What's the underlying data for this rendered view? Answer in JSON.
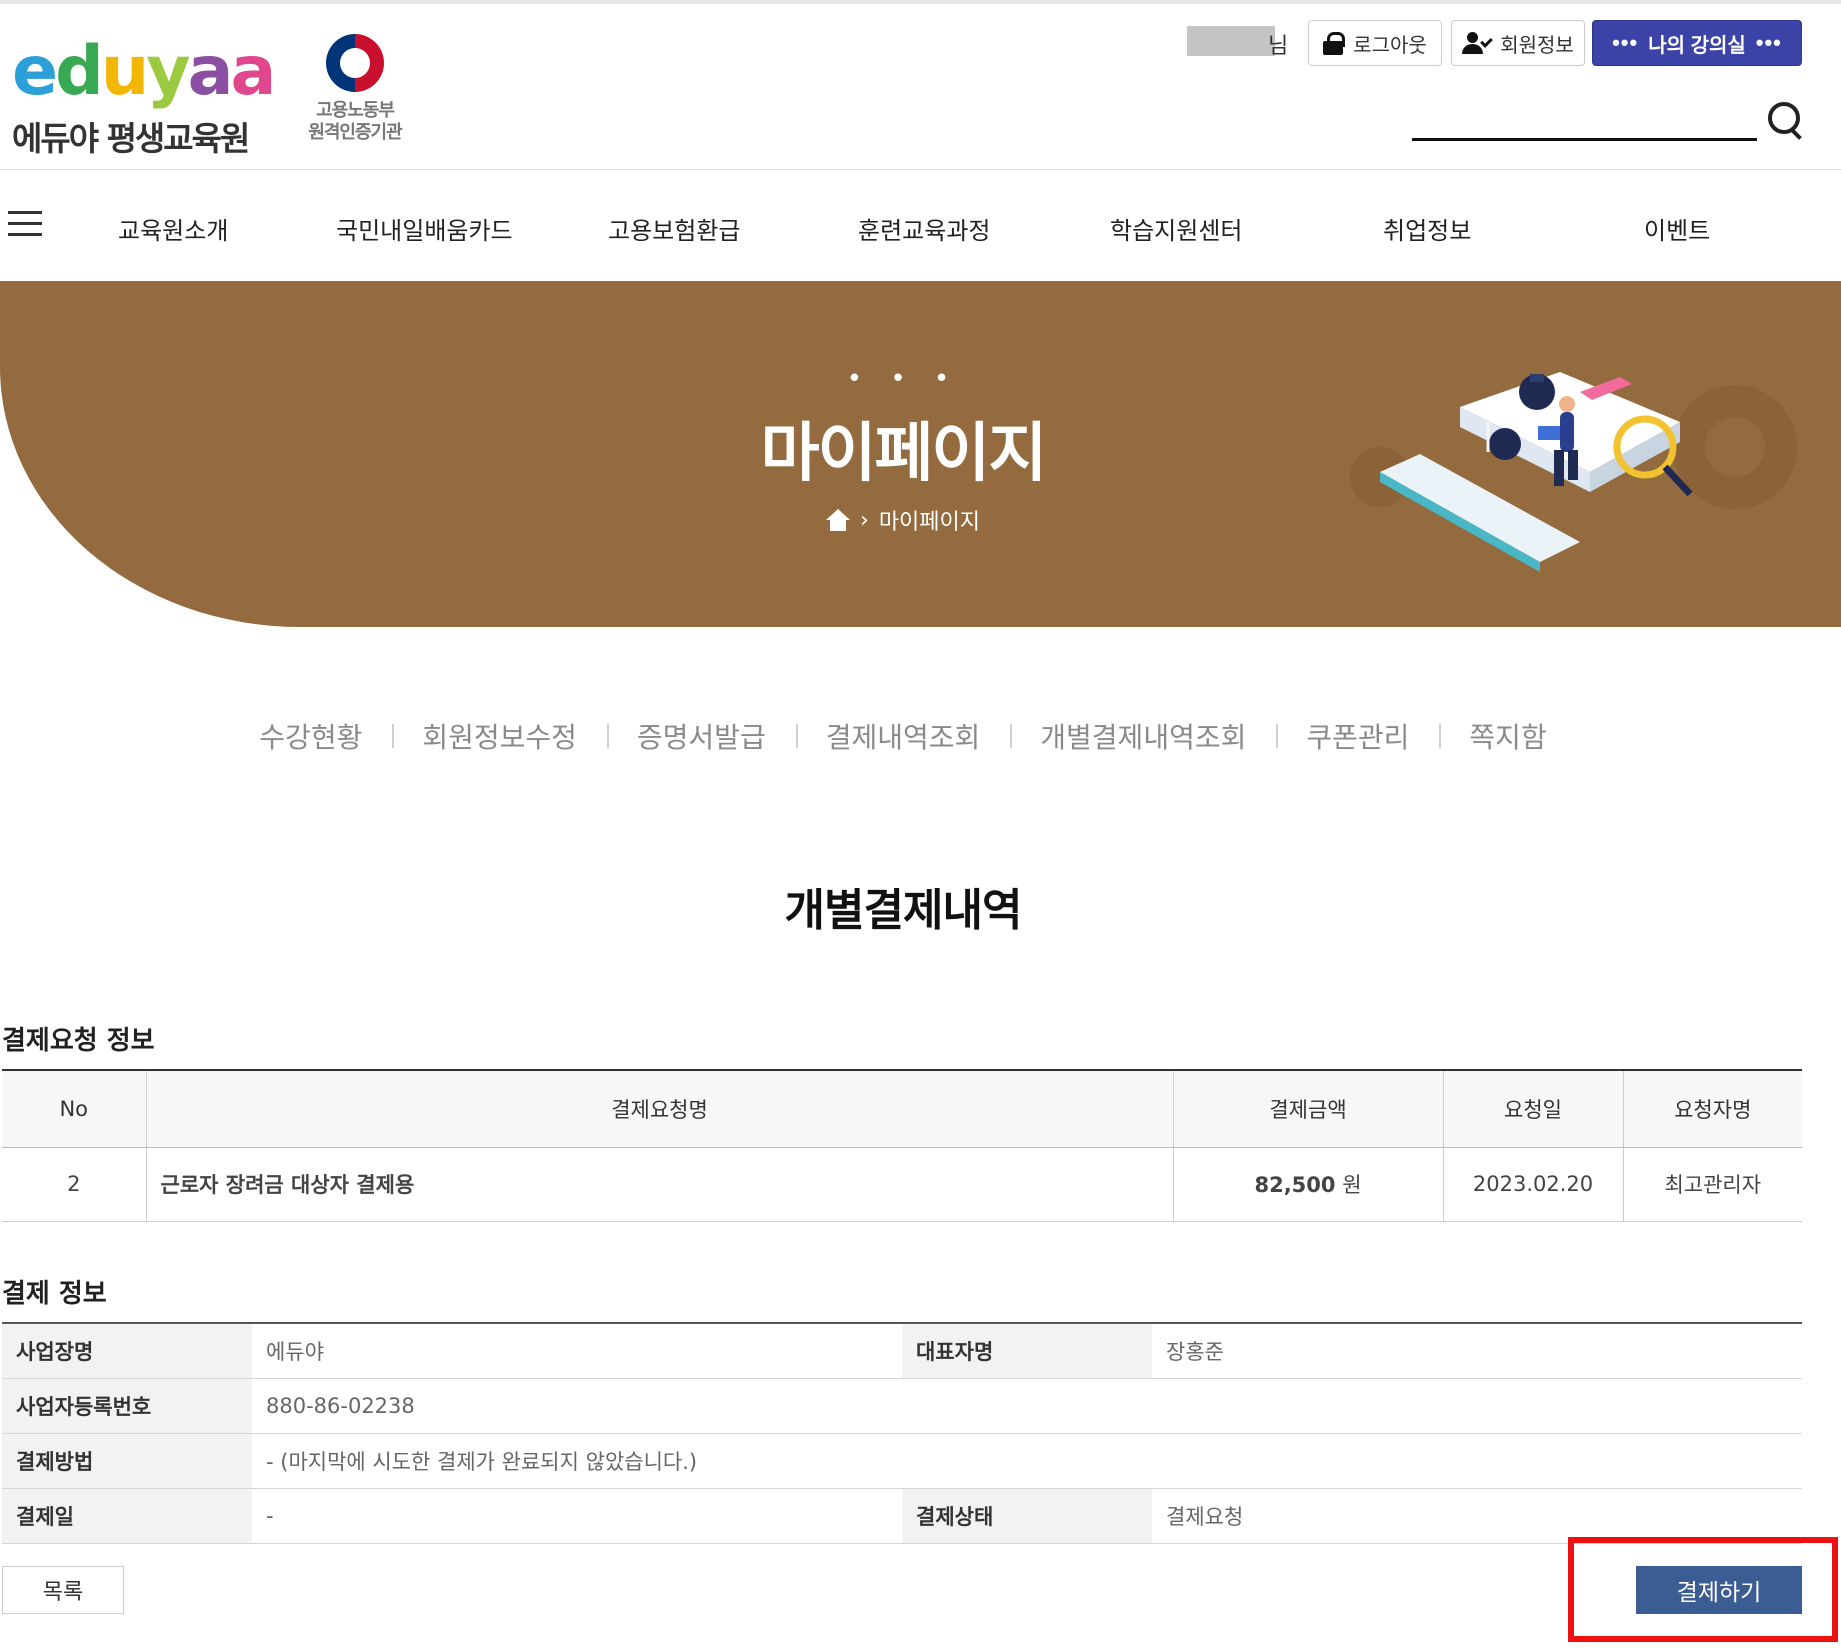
{
  "header": {
    "logo_text": "eduyaa",
    "logo_subtitle": "에듀야 평생교육원",
    "ministry_line1": "고용노동부",
    "ministry_line2": "원격인증기관",
    "user_suffix": "님",
    "logout_label": "로그아웃",
    "member_info_label": "회원정보",
    "classroom_label": "나의 강의실",
    "search_value": ""
  },
  "nav": {
    "items": [
      "교육원소개",
      "국민내일배움카드",
      "고용보험환급",
      "훈련교육과정",
      "학습지원센터",
      "취업정보",
      "이벤트"
    ]
  },
  "banner": {
    "dots": "• • •",
    "title": "마이페이지",
    "breadcrumb_sep": "›",
    "breadcrumb_current": "마이페이지"
  },
  "subtabs": [
    "수강현황",
    "회원정보수정",
    "증명서발급",
    "결제내역조회",
    "개별결제내역조회",
    "쿠폰관리",
    "쪽지함"
  ],
  "page_title": "개별결제내역",
  "request_section": {
    "title": "결제요청 정보",
    "headers": [
      "No",
      "결제요청명",
      "결제금액",
      "요청일",
      "요청자명"
    ],
    "row": {
      "no": "2",
      "name": "근로자 장려금 대상자 결제용",
      "amount": "82,500",
      "currency": "원",
      "date": "2023.02.20",
      "requester": "최고관리자"
    }
  },
  "payment_section": {
    "title": "결제 정보",
    "business_name_label": "사업장명",
    "business_name": "에듀야",
    "ceo_label": "대표자명",
    "ceo": "장홍준",
    "reg_no_label": "사업자등록번호",
    "reg_no": "880-86-02238",
    "method_label": "결제방법",
    "method": "- (마지막에 시도한 결제가 완료되지 않았습니다.)",
    "date_label": "결제일",
    "date": "-",
    "status_label": "결제상태",
    "status": "결제요청"
  },
  "buttons": {
    "list": "목록",
    "pay": "결제하기"
  },
  "colors": {
    "banner": "#946b3f",
    "classroom_button": "#3b43a6",
    "pay_button": "#3c5c94",
    "highlight": "#ee1111"
  }
}
